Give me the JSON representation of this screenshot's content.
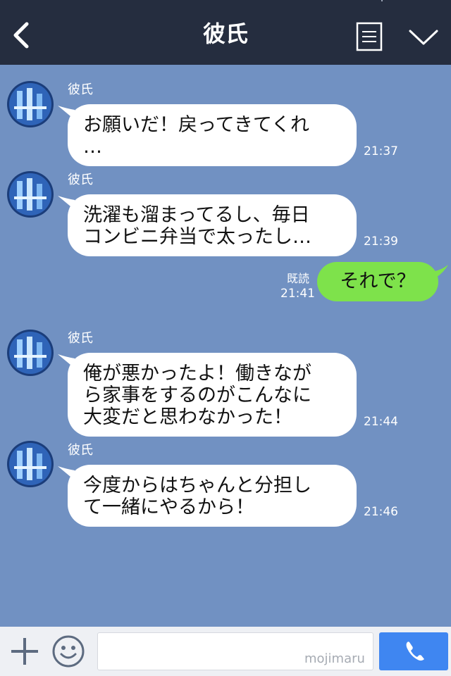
{
  "header": {
    "title": "彼氏",
    "icons": [
      "back-chevron-icon",
      "menu-icon",
      "chevron-down-icon"
    ]
  },
  "messages": [
    {
      "sender": "彼氏",
      "lines": [
        "お願いだ！戻ってきてくれ",
        "…"
      ],
      "time": "21:37"
    },
    {
      "sender": "彼氏",
      "lines": [
        "洗濯も溜まってるし、毎日",
        "コンビニ弁当で太ったし…"
      ],
      "time": "21:39"
    },
    {
      "read": "既読",
      "read_time": "21:41",
      "text": "それで？"
    },
    {
      "sender": "彼氏",
      "lines": [
        "俺が悪かったよ！働きなが",
        "ら家事をするのがこんなに",
        "大変だと思わなかった！"
      ],
      "time": "21:44"
    },
    {
      "sender": "彼氏",
      "lines": [
        "今度からはちゃんと分担し",
        "て一緒にやるから！"
      ],
      "time": "21:46"
    }
  ],
  "footer": {
    "input_value": "",
    "watermark": "mojimaru",
    "icons": [
      "plus-icon",
      "emoji-icon",
      "phone-icon"
    ]
  },
  "colors": {
    "header_bg": "#252d3f",
    "chat_bg": "#7191c2",
    "my_bubble": "#7ee24b",
    "call_button": "#3f86f1"
  }
}
